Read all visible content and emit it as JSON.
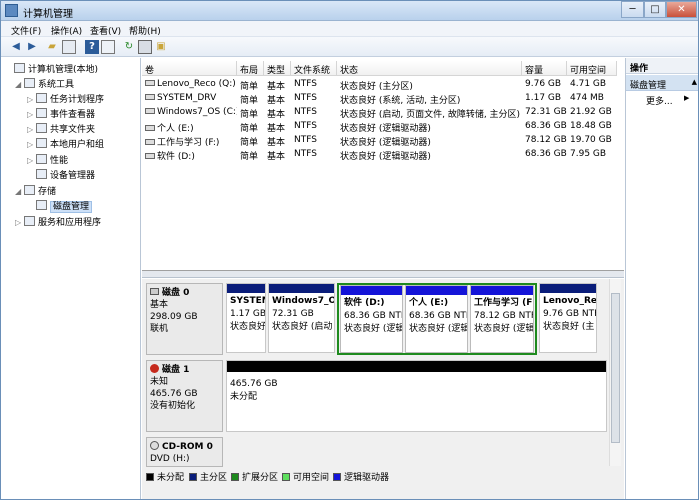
{
  "window": {
    "title": "计算机管理",
    "minimize": "─",
    "maximize": "□",
    "close": "✕"
  },
  "menu": [
    "文件(F)",
    "操作(A)",
    "查看(V)",
    "帮助(H)"
  ],
  "toolbar": {
    "icons": [
      "back-arrow-icon",
      "forward-arrow-icon",
      "up-folder-icon",
      "show-hide-tree-icon",
      "help-icon",
      "properties-icon",
      "refresh-icon",
      "export-icon",
      "help-book-icon"
    ]
  },
  "tree": [
    {
      "label": "计算机管理(本地)",
      "level": 0,
      "toggle": "",
      "icon": "computer-icon"
    },
    {
      "label": "系统工具",
      "level": 1,
      "toggle": "◢",
      "icon": "tools-icon"
    },
    {
      "label": "任务计划程序",
      "level": 2,
      "toggle": "▷",
      "icon": "clock-icon"
    },
    {
      "label": "事件查看器",
      "level": 2,
      "toggle": "▷",
      "icon": "event-icon"
    },
    {
      "label": "共享文件夹",
      "level": 2,
      "toggle": "▷",
      "icon": "folder-icon"
    },
    {
      "label": "本地用户和组",
      "level": 2,
      "toggle": "▷",
      "icon": "users-icon"
    },
    {
      "label": "性能",
      "level": 2,
      "toggle": "▷",
      "icon": "performance-icon"
    },
    {
      "label": "设备管理器",
      "level": 2,
      "toggle": "",
      "icon": "device-icon"
    },
    {
      "label": "存储",
      "level": 1,
      "toggle": "◢",
      "icon": "storage-icon"
    },
    {
      "label": "磁盘管理",
      "level": 2,
      "toggle": "",
      "icon": "disk-icon",
      "selected": true
    },
    {
      "label": "服务和应用程序",
      "level": 1,
      "toggle": "▷",
      "icon": "services-icon"
    }
  ],
  "table": {
    "headers": [
      "卷",
      "布局",
      "类型",
      "文件系统",
      "状态",
      "容量",
      "可用空间"
    ],
    "rows": [
      [
        "Lenovo_Reco (Q:)",
        "简单",
        "基本",
        "NTFS",
        "状态良好 (主分区)",
        "9.76 GB",
        "4.71 GB"
      ],
      [
        "SYSTEM_DRV",
        "简单",
        "基本",
        "NTFS",
        "状态良好 (系统, 活动, 主分区)",
        "1.17 GB",
        "474 MB"
      ],
      [
        "Windows7_OS (C:)",
        "简单",
        "基本",
        "NTFS",
        "状态良好 (启动, 页面文件, 故障转储, 主分区)",
        "72.31 GB",
        "21.92 GB"
      ],
      [
        "个人 (E:)",
        "简单",
        "基本",
        "NTFS",
        "状态良好 (逻辑驱动器)",
        "68.36 GB",
        "18.48 GB"
      ],
      [
        "工作与学习 (F:)",
        "简单",
        "基本",
        "NTFS",
        "状态良好 (逻辑驱动器)",
        "78.12 GB",
        "19.70 GB"
      ],
      [
        "软件 (D:)",
        "简单",
        "基本",
        "NTFS",
        "状态良好 (逻辑驱动器)",
        "68.36 GB",
        "7.95 GB"
      ]
    ]
  },
  "disks": [
    {
      "name": "磁盘 0",
      "type": "基本",
      "size": "298.09 GB",
      "status": "联机",
      "partitions": [
        {
          "name": "SYSTEM",
          "size": "1.17 GB",
          "status": "状态良好",
          "kind": "primary"
        },
        {
          "name": "Windows7_OS",
          "size": "72.31 GB",
          "status": "状态良好 (启动",
          "kind": "primary"
        },
        {
          "name": "软件  (D:)",
          "size": "68.36 GB NTF",
          "status": "状态良好 (逻辑",
          "kind": "logical"
        },
        {
          "name": "个人  (E:)",
          "size": "68.36 GB NTF",
          "status": "状态良好 (逻辑",
          "kind": "logical"
        },
        {
          "name": "工作与学习  (F",
          "size": "78.12 GB NTF",
          "status": "状态良好 (逻辑",
          "kind": "logical"
        },
        {
          "name": "Lenovo_Re",
          "size": "9.76 GB NTF",
          "status": "状态良好 (主",
          "kind": "primary"
        }
      ]
    },
    {
      "name": "磁盘 1",
      "type": "未知",
      "size": "465.76 GB",
      "status": "没有初始化",
      "partitions": [
        {
          "name": "",
          "size": "465.76 GB",
          "status": "未分配",
          "kind": "unallocated"
        }
      ]
    },
    {
      "name": "CD-ROM 0",
      "type": "DVD (H:)",
      "size": "",
      "status": "",
      "partitions": []
    }
  ],
  "legend": [
    {
      "label": "未分配",
      "color": "#000000"
    },
    {
      "label": "主分区",
      "color": "#0a1d7a"
    },
    {
      "label": "扩展分区",
      "color": "#1e8a1e"
    },
    {
      "label": "可用空间",
      "color": "#5fe05f"
    },
    {
      "label": "逻辑驱动器",
      "color": "#1414d8"
    }
  ],
  "actions": {
    "header": "操作",
    "section": "磁盘管理",
    "more": "更多...",
    "arrow": "▲",
    "more_arrow": "▶"
  },
  "colors": {
    "primary": "#0a1d7a",
    "logical": "#1414d8",
    "extended": "#1e8a1e",
    "unallocated": "#000000"
  }
}
